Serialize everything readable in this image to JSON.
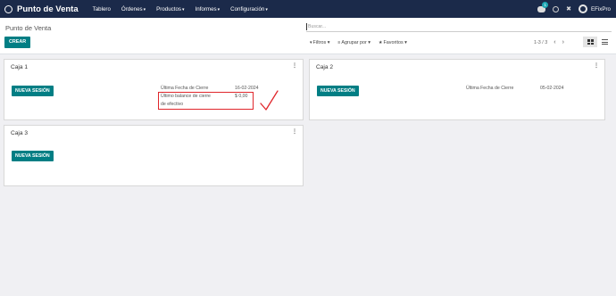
{
  "navbar": {
    "brand": "Punto de Venta",
    "menu": [
      "Tablero",
      "Órdenes",
      "Productos",
      "Informes",
      "Configuración"
    ],
    "menu_has_dropdown": [
      false,
      true,
      true,
      true,
      true
    ],
    "messages_badge": "1",
    "user_name": "EFixPro"
  },
  "control_panel": {
    "title": "Punto de Venta",
    "create_label": "CREAR",
    "search_placeholder": "Buscar...",
    "filters_label": "Filtros",
    "group_by_label": "Agrupar por",
    "favorites_label": "Favoritos",
    "pager_value": "1-3 / 3"
  },
  "cards": [
    {
      "title": "Caja 1",
      "session_button": "NUEVA SESIÓN",
      "last_close_label": "Última Fecha de Cierre",
      "last_close_value": "16-02-2024",
      "last_balance_label_line1": "Último balance de cierre",
      "last_balance_label_line2": "de efectivo",
      "last_balance_value": "$ 0,00"
    },
    {
      "title": "Caja 2",
      "session_button": "NUEVA SESIÓN",
      "last_close_label": "Última Fecha de Cierre",
      "last_close_value": "05-02-2024"
    },
    {
      "title": "Caja 3",
      "session_button": "NUEVA SESIÓN"
    }
  ],
  "colors": {
    "navbar_bg": "#1b2a4a",
    "accent": "#017e84",
    "annotation_red": "#e0262b"
  },
  "icons": [
    "apps-icon",
    "chat-icon",
    "clock-icon",
    "tools-icon",
    "avatar",
    "filter-icon",
    "group-icon",
    "star-icon",
    "chevron-left-icon",
    "chevron-right-icon",
    "kanban-view-icon",
    "list-view-icon",
    "card-menu-icon",
    "check-mark-icon"
  ]
}
